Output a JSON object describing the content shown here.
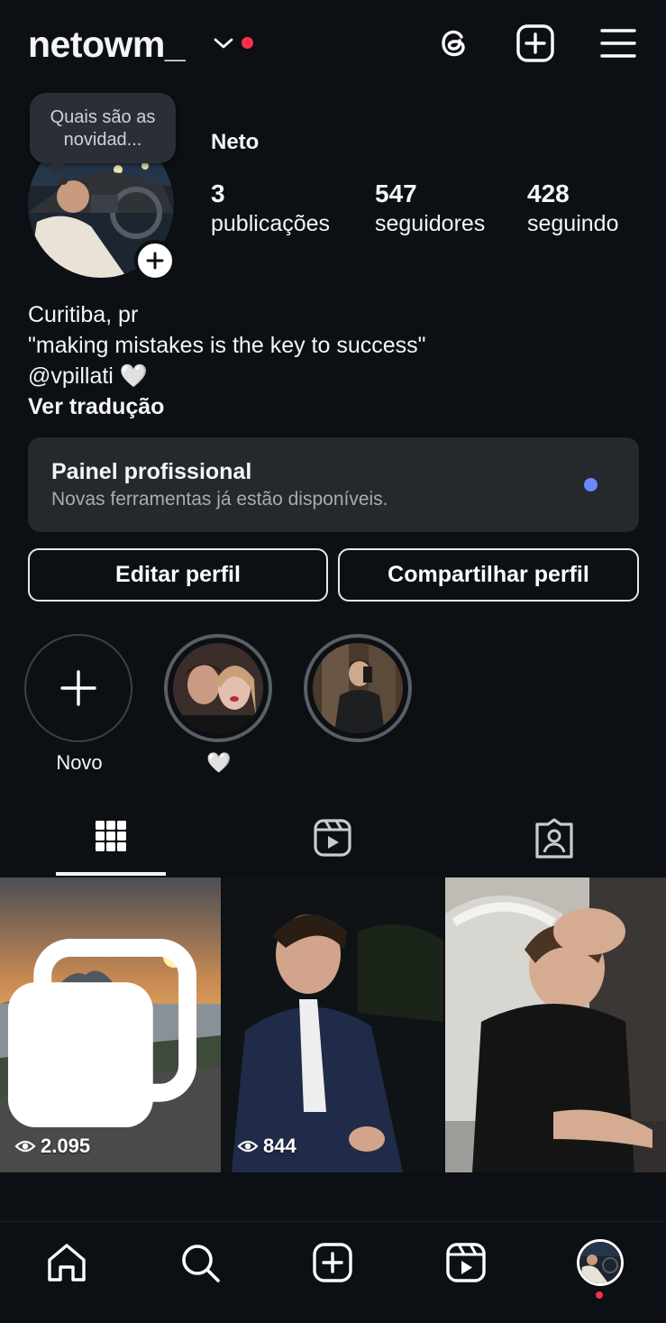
{
  "header": {
    "username": "netowm_",
    "icons": [
      "threads-icon",
      "create-icon",
      "menu-icon"
    ]
  },
  "profile": {
    "note": "Quais são as novidad...",
    "display_name": "Neto",
    "stats": [
      {
        "value": "3",
        "label": "publicações"
      },
      {
        "value": "547",
        "label": "seguidores"
      },
      {
        "value": "428",
        "label": "seguindo"
      }
    ],
    "bio_lines": [
      "Curitiba, pr",
      "\"making mistakes is the key to success\"",
      "@vpillati 🤍"
    ],
    "translate_link": "Ver tradução"
  },
  "dashboard": {
    "title": "Painel profissional",
    "subtitle": "Novas ferramentas já estão disponíveis.",
    "dot_color": "#6b86ff"
  },
  "actions": {
    "edit_label": "Editar perfil",
    "share_label": "Compartilhar perfil"
  },
  "highlights": [
    {
      "label": "Novo"
    },
    {
      "label": "🤍"
    },
    {
      "label": ""
    }
  ],
  "tabs": [
    "grid-icon",
    "reels-icon",
    "tagged-icon"
  ],
  "posts": [
    {
      "views": "2.095",
      "multi": true
    },
    {
      "views": "844",
      "multi": false
    },
    {
      "views": "",
      "multi": false
    }
  ],
  "bottom_nav": [
    "home-icon",
    "search-icon",
    "create-icon",
    "reels-icon",
    "profile-avatar"
  ],
  "colors": {
    "background": "#0c1014",
    "notification_red": "#ff2d4b",
    "card": "#25292e"
  }
}
